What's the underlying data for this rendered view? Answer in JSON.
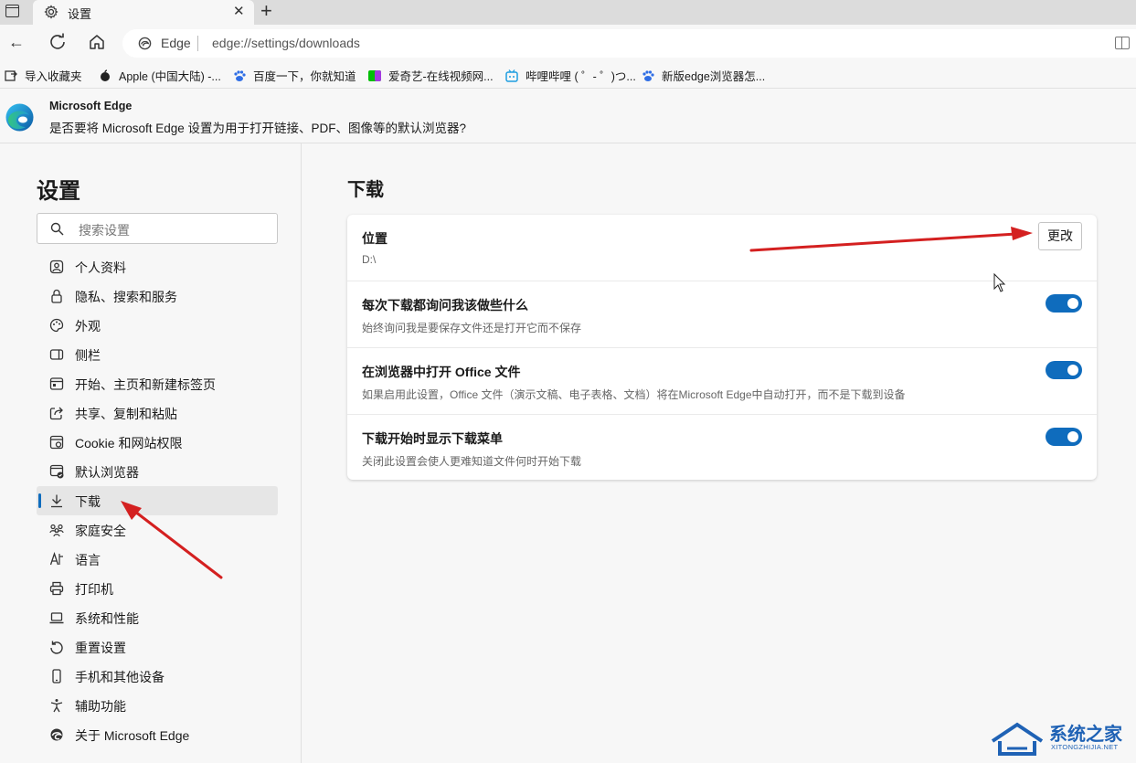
{
  "browser": {
    "tab_title": "设置",
    "site_label": "Edge",
    "url": "edge://settings/downloads"
  },
  "bookmarks": [
    {
      "label": "导入收藏夹",
      "icon": "import-favorites-icon"
    },
    {
      "label": "Apple (中国大陆) -...",
      "icon": "apple-icon"
    },
    {
      "label": "百度一下，你就知道",
      "icon": "baidu-icon"
    },
    {
      "label": "爱奇艺-在线视频网...",
      "icon": "iqiyi-icon"
    },
    {
      "label": "哔哩哔哩 ( ゜- ゜)つ...",
      "icon": "bilibili-icon"
    },
    {
      "label": "新版edge浏览器怎...",
      "icon": "baidu-icon"
    }
  ],
  "infobar": {
    "title": "Microsoft Edge",
    "message": "是否要将 Microsoft Edge 设置为用于打开链接、PDF、图像等的默认浏览器?"
  },
  "sidebar": {
    "title": "设置",
    "search_placeholder": "搜索设置",
    "items": [
      {
        "label": "个人资料",
        "icon": "profile-icon"
      },
      {
        "label": "隐私、搜索和服务",
        "icon": "lock-icon"
      },
      {
        "label": "外观",
        "icon": "palette-icon"
      },
      {
        "label": "侧栏",
        "icon": "sidebar-icon"
      },
      {
        "label": "开始、主页和新建标签页",
        "icon": "home-tab-icon"
      },
      {
        "label": "共享、复制和粘贴",
        "icon": "share-icon"
      },
      {
        "label": "Cookie 和网站权限",
        "icon": "cookie-icon"
      },
      {
        "label": "默认浏览器",
        "icon": "default-browser-icon"
      },
      {
        "label": "下载",
        "icon": "download-icon",
        "active": true
      },
      {
        "label": "家庭安全",
        "icon": "family-icon"
      },
      {
        "label": "语言",
        "icon": "language-icon"
      },
      {
        "label": "打印机",
        "icon": "printer-icon"
      },
      {
        "label": "系统和性能",
        "icon": "laptop-icon"
      },
      {
        "label": "重置设置",
        "icon": "reset-icon"
      },
      {
        "label": "手机和其他设备",
        "icon": "phone-icon"
      },
      {
        "label": "辅助功能",
        "icon": "accessibility-icon"
      },
      {
        "label": "关于 Microsoft Edge",
        "icon": "edge-icon"
      }
    ]
  },
  "main": {
    "title": "下载",
    "location": {
      "title": "位置",
      "value": "D:\\",
      "button": "更改"
    },
    "settings": [
      {
        "title": "每次下载都询问我该做些什么",
        "desc": "始终询问我是要保存文件还是打开它而不保存",
        "on": true
      },
      {
        "title": "在浏览器中打开 Office 文件",
        "desc": "如果启用此设置，Office 文件（演示文稿、电子表格、文档）将在Microsoft Edge中自动打开，而不是下载到设备",
        "on": true
      },
      {
        "title": "下载开始时显示下载菜单",
        "desc": "关闭此设置会使人更难知道文件何时开始下载",
        "on": true
      }
    ]
  },
  "watermark": {
    "text": "系统之家",
    "subtext": "XITONGZHIJIA.NET"
  },
  "colors": {
    "accent": "#0f6cbd",
    "annotation_arrow": "#d42020"
  }
}
